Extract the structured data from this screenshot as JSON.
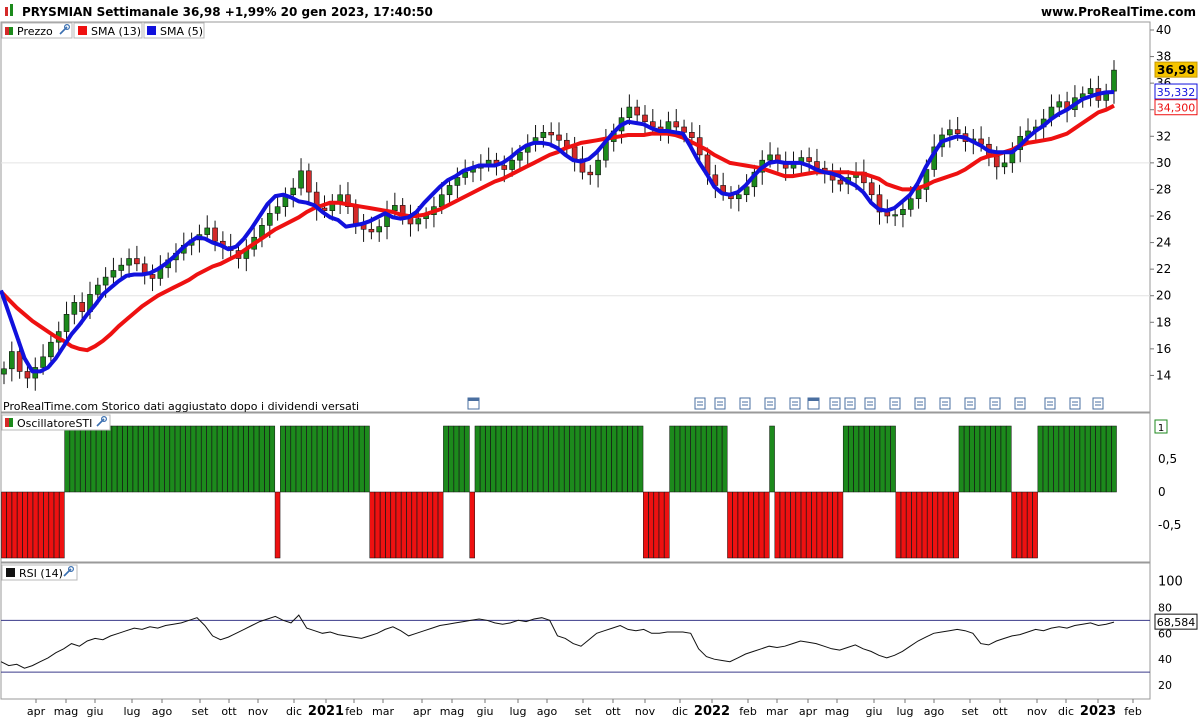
{
  "header": {
    "title": "PRYSMIAN Settimanale 36,98 +1,99% 20 gen 2023, 17:40:50",
    "brand": "www.ProRealTime.com"
  },
  "price_panel": {
    "legend": [
      {
        "label": "Prezzo",
        "color": "#d42a2a",
        "color2": "#1c8a1c",
        "icon": "wrench-icon"
      },
      {
        "label": "SMA (13)",
        "color": "#ee1111"
      },
      {
        "label": "SMA (5)",
        "color": "#1111dd"
      }
    ],
    "footer_note": "ProRealTime.com  Storico dati aggiustato dopo i dividendi versati",
    "labels": {
      "last": {
        "text": "36,98",
        "value": 36.98,
        "bg": "#f5c400"
      },
      "sma5": {
        "text": "35,332",
        "value": 35.332,
        "color": "#1111dd"
      },
      "sma13": {
        "text": "34,300",
        "value": 34.3,
        "color": "#ee1111"
      }
    }
  },
  "osc_panel": {
    "legend": {
      "label": "OscillatoreSTI",
      "icon": "wrench-icon"
    },
    "last_label": "1",
    "up_color": "#1c8a1c",
    "down_color": "#ee1111"
  },
  "rsi_panel": {
    "legend": {
      "label": "RSI (14)",
      "icon": "wrench-icon"
    },
    "last_label": "68,584",
    "value": 68.584
  },
  "x_axis": [
    {
      "label": "apr",
      "bold": false
    },
    {
      "label": "mag",
      "bold": false
    },
    {
      "label": "giu",
      "bold": false
    },
    {
      "label": "lug",
      "bold": false
    },
    {
      "label": "ago",
      "bold": false
    },
    {
      "label": "set",
      "bold": false
    },
    {
      "label": "ott",
      "bold": false
    },
    {
      "label": "nov",
      "bold": false
    },
    {
      "label": "dic",
      "bold": false
    },
    {
      "label": "2021",
      "bold": true
    },
    {
      "label": "feb",
      "bold": false
    },
    {
      "label": "mar",
      "bold": false
    },
    {
      "label": "apr",
      "bold": false
    },
    {
      "label": "mag",
      "bold": false
    },
    {
      "label": "giu",
      "bold": false
    },
    {
      "label": "lug",
      "bold": false
    },
    {
      "label": "ago",
      "bold": false
    },
    {
      "label": "set",
      "bold": false
    },
    {
      "label": "ott",
      "bold": false
    },
    {
      "label": "nov",
      "bold": false
    },
    {
      "label": "dic",
      "bold": false
    },
    {
      "label": "2022",
      "bold": true
    },
    {
      "label": "feb",
      "bold": false
    },
    {
      "label": "mar",
      "bold": false
    },
    {
      "label": "apr",
      "bold": false
    },
    {
      "label": "mag",
      "bold": false
    },
    {
      "label": "giu",
      "bold": false
    },
    {
      "label": "lug",
      "bold": false
    },
    {
      "label": "ago",
      "bold": false
    },
    {
      "label": "set",
      "bold": false
    },
    {
      "label": "ott",
      "bold": false
    },
    {
      "label": "nov",
      "bold": false
    },
    {
      "label": "dic",
      "bold": false
    },
    {
      "label": "2023",
      "bold": true
    },
    {
      "label": "feb",
      "bold": false
    }
  ],
  "chart_data": [
    {
      "type": "candlestick",
      "series_names": [
        "Prezzo",
        "SMA (13)",
        "SMA (5)"
      ],
      "ylim": [
        12,
        40
      ],
      "yticks": [
        14,
        16,
        18,
        20,
        22,
        24,
        26,
        28,
        30,
        32,
        34,
        36,
        38,
        40
      ],
      "ytick_labels": [
        "14",
        "16",
        "18",
        "20",
        "22",
        "24",
        "26",
        "28",
        "30",
        "32",
        "34",
        "36",
        "38",
        "40"
      ],
      "grid_lines": [
        20,
        30
      ],
      "close_series": [
        14.5,
        15.8,
        14.3,
        13.8,
        14.6,
        15.4,
        16.5,
        17.3,
        18.6,
        19.5,
        18.8,
        20.1,
        20.8,
        21.4,
        21.9,
        22.3,
        22.8,
        22.4,
        21.6,
        21.3,
        22.1,
        22.7,
        23.2,
        23.8,
        24.2,
        24.6,
        25.1,
        24.1,
        23.7,
        23.4,
        22.8,
        23.5,
        24.4,
        25.3,
        26.2,
        26.7,
        27.6,
        28.1,
        29.4,
        27.8,
        26.6,
        26.4,
        27.1,
        27.6,
        26.7,
        25.4,
        25.0,
        24.8,
        25.2,
        26.4,
        26.8,
        26.1,
        25.4,
        25.8,
        26.1,
        26.7,
        27.6,
        28.3,
        28.9,
        29.3,
        29.6,
        29.9,
        30.2,
        29.8,
        29.5,
        30.2,
        30.8,
        31.4,
        31.9,
        32.3,
        32.1,
        31.7,
        31.2,
        30.3,
        29.3,
        29.1,
        30.2,
        31.6,
        32.4,
        33.4,
        34.2,
        33.6,
        33.1,
        32.7,
        32.4,
        33.1,
        32.7,
        32.3,
        31.9,
        30.6,
        29.1,
        28.3,
        27.7,
        27.3,
        27.6,
        28.2,
        29.3,
        30.2,
        30.6,
        30.1,
        29.6,
        29.9,
        30.4,
        30.1,
        29.6,
        29.2,
        28.7,
        28.4,
        28.9,
        29.3,
        28.5,
        27.6,
        26.3,
        26.0,
        26.1,
        26.5,
        27.3,
        28.0,
        29.5,
        31.2,
        32.1,
        32.5,
        32.2,
        31.6,
        31.8,
        31.4,
        30.5,
        29.7,
        30.0,
        31.0,
        32.0,
        32.4,
        32.7,
        33.3,
        34.2,
        34.6,
        34.0,
        34.9,
        35.2,
        35.6,
        34.7,
        35.4,
        36.98
      ],
      "sma13": [
        20.3,
        19.7,
        19.1,
        18.6,
        18.1,
        17.7,
        17.3,
        16.9,
        16.6,
        16.2,
        16.0,
        15.9,
        16.2,
        16.6,
        17.1,
        17.7,
        18.2,
        18.7,
        19.2,
        19.6,
        20.0,
        20.3,
        20.6,
        20.9,
        21.2,
        21.6,
        21.9,
        22.2,
        22.4,
        22.7,
        23.0,
        23.4,
        23.8,
        24.2,
        24.6,
        25.0,
        25.3,
        25.6,
        25.9,
        26.3,
        26.6,
        26.8,
        27.0,
        27.0,
        26.9,
        26.8,
        26.7,
        26.6,
        26.5,
        26.4,
        26.3,
        26.1,
        26.0,
        26.0,
        26.1,
        26.3,
        26.5,
        26.8,
        27.1,
        27.4,
        27.7,
        28.0,
        28.3,
        28.6,
        28.8,
        29.1,
        29.4,
        29.7,
        30.0,
        30.3,
        30.6,
        30.8,
        31.1,
        31.3,
        31.5,
        31.6,
        31.7,
        31.8,
        31.9,
        32.0,
        32.1,
        32.1,
        32.1,
        32.2,
        32.2,
        32.2,
        32.1,
        31.9,
        31.6,
        31.3,
        31.0,
        30.6,
        30.3,
        30.0,
        29.9,
        29.8,
        29.7,
        29.6,
        29.4,
        29.2,
        29.0,
        29.0,
        29.1,
        29.2,
        29.3,
        29.3,
        29.3,
        29.3,
        29.3,
        29.2,
        29.2,
        29.0,
        28.8,
        28.4,
        28.2,
        28.0,
        28.0,
        28.1,
        28.3,
        28.6,
        28.8,
        29.0,
        29.2,
        29.5,
        29.9,
        30.3,
        30.5,
        30.6,
        30.8,
        31.0,
        31.3,
        31.5,
        31.6,
        31.7,
        31.8,
        32.0,
        32.2,
        32.6,
        33.0,
        33.4,
        33.8,
        34.0,
        34.3
      ],
      "sma5": [
        20.4,
        18.7,
        17.0,
        15.3,
        14.3,
        14.3,
        14.6,
        15.3,
        16.2,
        17.1,
        17.8,
        18.6,
        19.3,
        20.1,
        20.6,
        21.1,
        21.5,
        21.6,
        21.6,
        21.7,
        22.0,
        22.4,
        22.9,
        23.5,
        24.0,
        24.4,
        24.3,
        24.0,
        23.8,
        23.5,
        23.7,
        24.3,
        25.1,
        26.0,
        26.9,
        27.5,
        27.6,
        27.4,
        27.1,
        27.0,
        26.8,
        26.3,
        25.9,
        25.7,
        25.2,
        25.3,
        25.4,
        25.6,
        25.9,
        26.2,
        25.9,
        25.8,
        25.9,
        26.3,
        27.0,
        27.6,
        28.2,
        28.7,
        29.0,
        29.4,
        29.6,
        29.8,
        29.8,
        29.8,
        30.0,
        30.4,
        30.9,
        31.3,
        31.5,
        31.5,
        31.4,
        31.1,
        30.6,
        30.2,
        30.1,
        30.3,
        30.8,
        31.5,
        32.2,
        32.8,
        33.1,
        33.0,
        32.9,
        32.6,
        32.4,
        32.4,
        32.3,
        32.2,
        31.2,
        30.1,
        29.2,
        28.2,
        27.7,
        27.6,
        27.8,
        28.3,
        29.0,
        29.6,
        30.0,
        30.1,
        30.0,
        30.0,
        30.0,
        29.8,
        29.5,
        29.3,
        29.2,
        29.0,
        28.6,
        28.3,
        27.8,
        27.0,
        26.5,
        26.4,
        26.6,
        27.1,
        27.6,
        28.5,
        29.7,
        30.7,
        31.6,
        31.8,
        32.0,
        31.9,
        31.6,
        31.3,
        30.9,
        30.8,
        30.8,
        30.8,
        31.3,
        31.9,
        32.4,
        32.8,
        33.3,
        33.7,
        34.0,
        34.4,
        34.8,
        35.0,
        35.2,
        35.3,
        35.332
      ]
    },
    {
      "type": "bar",
      "series_names": [
        "OscillatoreSTI"
      ],
      "ylim": [
        -1,
        1
      ],
      "yticks": [
        1,
        0.5,
        0,
        -0.5
      ],
      "ytick_labels": [
        "1",
        "0,5",
        "0",
        "-0,5"
      ],
      "values": [
        -1,
        -1,
        -1,
        -1,
        -1,
        -1,
        -1,
        -1,
        -1,
        -1,
        -1,
        -1,
        1,
        1,
        1,
        1,
        1,
        1,
        1,
        1,
        1,
        1,
        1,
        1,
        1,
        1,
        1,
        1,
        1,
        1,
        1,
        1,
        1,
        1,
        1,
        1,
        1,
        1,
        1,
        1,
        1,
        1,
        1,
        1,
        1,
        1,
        1,
        1,
        1,
        1,
        1,
        1,
        -1,
        1,
        1,
        1,
        1,
        1,
        1,
        1,
        1,
        1,
        1,
        1,
        1,
        1,
        1,
        1,
        1,
        1,
        -1,
        -1,
        -1,
        -1,
        -1,
        -1,
        -1,
        -1,
        -1,
        -1,
        -1,
        -1,
        -1,
        -1,
        1,
        1,
        1,
        1,
        1,
        -1,
        1,
        1,
        1,
        1,
        1,
        1,
        1,
        1,
        1,
        1,
        1,
        1,
        1,
        1,
        1,
        1,
        1,
        1,
        1,
        1,
        1,
        1,
        1,
        1,
        1,
        1,
        1,
        1,
        1,
        1,
        1,
        1,
        -1,
        -1,
        -1,
        -1,
        -1,
        1,
        1,
        1,
        1,
        1,
        1,
        1,
        1,
        1,
        1,
        1,
        -1,
        -1,
        -1,
        -1,
        -1,
        -1,
        -1,
        -1,
        1,
        -1,
        -1,
        -1,
        -1,
        -1,
        -1,
        -1,
        -1,
        -1,
        -1,
        -1,
        -1,
        -1,
        1,
        1,
        1,
        1,
        1,
        1,
        1,
        1,
        1,
        1,
        -1,
        -1,
        -1,
        -1,
        -1,
        -1,
        -1,
        -1,
        -1,
        -1,
        -1,
        -1,
        1,
        1,
        1,
        1,
        1,
        1,
        1,
        1,
        1,
        1,
        -1,
        -1,
        -1,
        -1,
        -1,
        1,
        1,
        1,
        1,
        1,
        1,
        1,
        1,
        1,
        1,
        1,
        1,
        1,
        1,
        1
      ]
    },
    {
      "type": "line",
      "series_names": [
        "RSI (14)"
      ],
      "ylim": [
        10,
        105
      ],
      "yticks": [
        100,
        80,
        60,
        40,
        20
      ],
      "ytick_labels": [
        "100",
        "80",
        "60",
        "40",
        "20"
      ],
      "reference_lines": [
        70,
        30
      ],
      "values": [
        38,
        35,
        36,
        33,
        35,
        38,
        41,
        45,
        48,
        52,
        50,
        54,
        56,
        55,
        58,
        60,
        62,
        64,
        63,
        65,
        64,
        66,
        67,
        68,
        70,
        72,
        66,
        58,
        55,
        57,
        60,
        63,
        66,
        69,
        71,
        73,
        70,
        68,
        74,
        64,
        62,
        60,
        61,
        59,
        58,
        57,
        56,
        58,
        60,
        63,
        65,
        62,
        58,
        60,
        62,
        64,
        66,
        67,
        68,
        69,
        70,
        71,
        70,
        68,
        67,
        68,
        70,
        69,
        71,
        72,
        70,
        58,
        56,
        52,
        50,
        55,
        60,
        62,
        64,
        66,
        63,
        62,
        63,
        60,
        60,
        61,
        61,
        61,
        60,
        48,
        42,
        40,
        39,
        38,
        41,
        44,
        46,
        48,
        50,
        49,
        50,
        52,
        54,
        53,
        52,
        50,
        48,
        47,
        49,
        51,
        48,
        46,
        43,
        41,
        43,
        46,
        50,
        54,
        57,
        60,
        61,
        62,
        63,
        62,
        60,
        52,
        51,
        54,
        56,
        58,
        59,
        61,
        63,
        62,
        64,
        65,
        64,
        66,
        67,
        68,
        66,
        67,
        68.584
      ]
    }
  ]
}
